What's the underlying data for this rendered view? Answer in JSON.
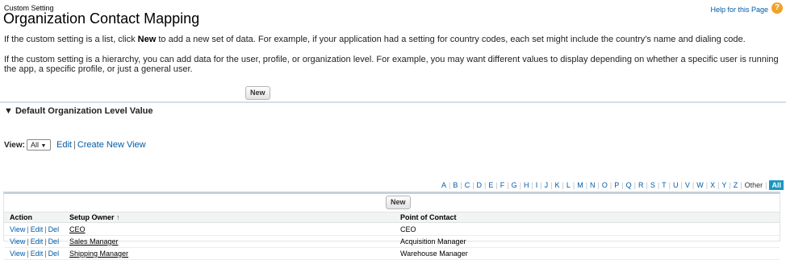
{
  "header": {
    "supertitle": "Custom Setting",
    "title": "Organization Contact Mapping",
    "help_link": "Help for this Page",
    "help_icon_glyph": "?"
  },
  "intro": {
    "list_text_before": "If the custom setting is a list, click ",
    "list_text_bold": "New",
    "list_text_after": " to add a new set of data. For example, if your application had a setting for country codes, each set might include the country's name and dialing code.",
    "hierarchy_text": "If the custom setting is a hierarchy, you can add data for the user, profile, or organization level. For example, you may want different values to display depending on whether a specific user is running the app, a specific profile, or just a general user."
  },
  "top_new_button": "New",
  "section": {
    "arrow": "▼",
    "title": "Default Organization Level Value"
  },
  "view": {
    "label": "View:",
    "selected": "All",
    "edit": "Edit",
    "create": "Create New View"
  },
  "letters": [
    "A",
    "B",
    "C",
    "D",
    "E",
    "F",
    "G",
    "H",
    "I",
    "J",
    "K",
    "L",
    "M",
    "N",
    "O",
    "P",
    "Q",
    "R",
    "S",
    "T",
    "U",
    "V",
    "W",
    "X",
    "Y",
    "Z",
    "Other",
    "All"
  ],
  "active_letter": "All",
  "list": {
    "new_button": "New",
    "columns": [
      "Action",
      "Setup Owner",
      "Point of Contact"
    ],
    "sort_icon": "↑",
    "actions": {
      "view": "View",
      "edit": "Edit",
      "del": "Del"
    },
    "rows": [
      {
        "owner": "CEO",
        "contact": "CEO"
      },
      {
        "owner": "Sales Manager",
        "contact": "Acquisition Manager"
      },
      {
        "owner": "Shipping Manager",
        "contact": "Warehouse Manager"
      }
    ]
  },
  "colors": {
    "link": "#015ba7",
    "accent": "#1797c0",
    "help_icon": "#f0a12c"
  }
}
